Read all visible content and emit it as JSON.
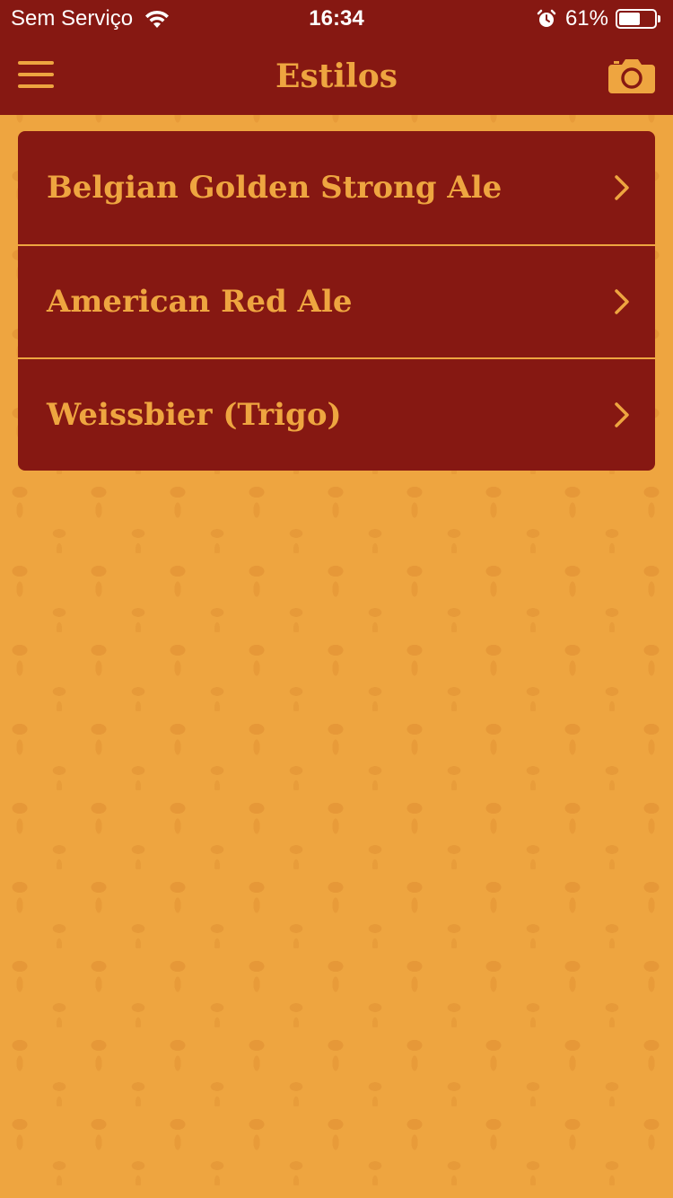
{
  "status_bar": {
    "carrier": "Sem Serviço",
    "time": "16:34",
    "battery_percent": "61%",
    "battery_level": 0.61,
    "icons": [
      "wifi-icon",
      "alarm-icon",
      "battery-icon"
    ]
  },
  "nav": {
    "title": "Estilos",
    "left_icon": "hamburger-menu-icon",
    "right_icon": "camera-icon"
  },
  "styles": [
    {
      "label": "Belgian Golden Strong Ale",
      "icon": "chevron-right-icon"
    },
    {
      "label": "American Red Ale",
      "icon": "chevron-right-icon"
    },
    {
      "label": "Weissbier (Trigo)",
      "icon": "chevron-right-icon"
    }
  ],
  "colors": {
    "primary": "#861812",
    "accent": "#EEA540",
    "status_text": "#FFFFFF"
  }
}
